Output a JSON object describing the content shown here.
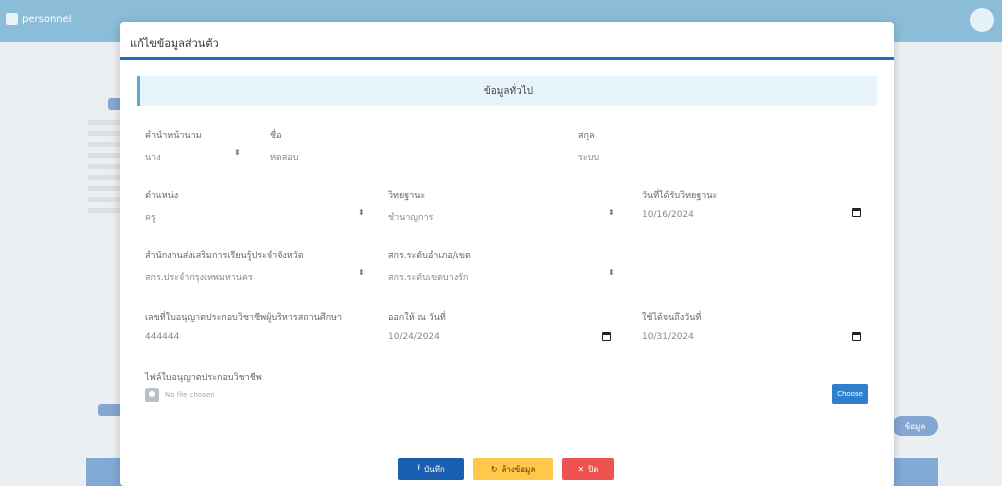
{
  "app": {
    "brand": "personnel",
    "user_name": ""
  },
  "modal": {
    "title": "แก้ไขข้อมูลส่วนตัว",
    "section_title": "ข้อมูลทั่วไป"
  },
  "form": {
    "prefix": {
      "label": "คำนำหน้านาม",
      "value": "นาง"
    },
    "first_name": {
      "label": "ชื่อ",
      "value": "ทดสอบ"
    },
    "last_name": {
      "label": "สกุล",
      "value": "ระบบ"
    },
    "position": {
      "label": "ตำแหน่ง",
      "value": "ครู"
    },
    "academic_rank": {
      "label": "วิทยฐานะ",
      "value": "ชำนาญการ"
    },
    "rank_date": {
      "label": "วันที่ได้รับวิทยฐานะ",
      "value": "10/16/2024"
    },
    "province_office": {
      "label": "สำนักงานส่งเสริมการเรียนรู้ประจำจังหวัด",
      "value": "สกร.ประจำกรุงเทพมหานคร"
    },
    "district_office": {
      "label": "สกร.ระดับอำเภอ/เขต",
      "value": "สกร.ระดับเขตบางรัก"
    },
    "license_no": {
      "label": "เลขที่ใบอนุญาตประกอบวิชาชีพผู้บริหารสถานศึกษา",
      "value": "444444"
    },
    "issue_date": {
      "label": "ออกให้ ณ วันที่",
      "value": "10/24/2024"
    },
    "expire_date": {
      "label": "ใช้ได้จนถึงวันที่",
      "value": "10/31/2024"
    },
    "upload": {
      "label": "ไฟล์ใบอนุญาตประกอบวิชาชีพ",
      "placeholder": "No file chosen",
      "choose_label": "Choose"
    }
  },
  "buttons": {
    "save": "บันทึก",
    "clear": "ล้างข้อมูล",
    "close": "ปิด"
  },
  "background": {
    "right_button": "ข้อมูล"
  },
  "colors": {
    "topbar": "#2d86b8",
    "accent": "#1e6fc2",
    "save": "#1b5fb0",
    "clear": "#ffc84a",
    "close": "#ef5350"
  }
}
